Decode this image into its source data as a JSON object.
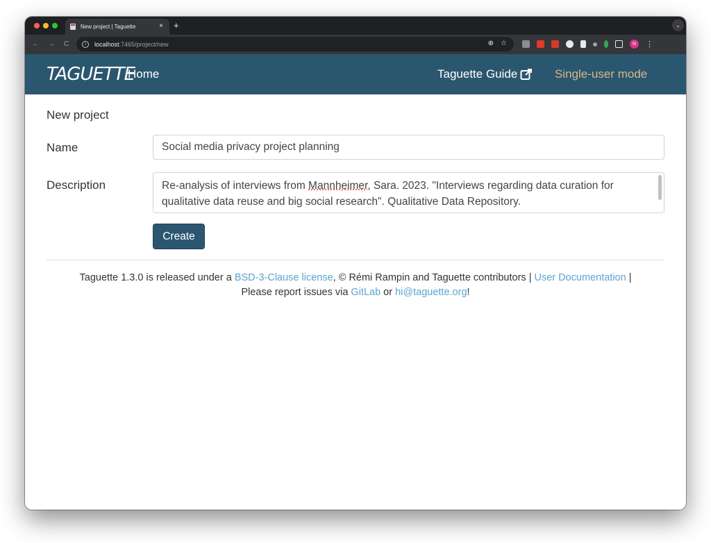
{
  "browser": {
    "tab_title": "New project | Taguette",
    "tab_close": "×",
    "new_tab": "+",
    "tab_menu": "⌄",
    "nav_back": "←",
    "nav_forward": "→",
    "nav_reload": "C",
    "url_host": "localhost",
    "url_path": ":7465/project/new",
    "zoom_icon": "⊕",
    "bookmark_icon": "☆",
    "profile_initial": "N",
    "menu_icon": "⋮"
  },
  "nav": {
    "brand": "TAGUETTE",
    "home": "Home",
    "guide": "Taguette Guide",
    "mode": "Single-user mode"
  },
  "form": {
    "title": "New project",
    "name_label": "Name",
    "name_value": "Social media privacy project planning",
    "description_label": "Description",
    "description_prefix": "Re-analysis of interviews from ",
    "description_spell": "Mannheimer",
    "description_suffix": ", Sara. 2023. \"Interviews regarding data curation for qualitative data reuse and big social research\". Qualitative Data Repository.",
    "create_label": "Create"
  },
  "footer": {
    "t1": "Taguette 1.3.0 is released under a ",
    "license_link": "BSD-3-Clause license",
    "t2": ", © Rémi Rampin and Taguette contributors | ",
    "docs_link": "User Documentation",
    "t3": " |",
    "t4": "Please report issues via ",
    "gitlab_link": "GitLab",
    "t5": " or ",
    "email_link": "hi@taguette.org",
    "t6": "!"
  },
  "colors": {
    "navbar": "#2b566f",
    "mode_link": "#d9b88a",
    "link": "#5ba4cf",
    "button": "#2b566f"
  }
}
